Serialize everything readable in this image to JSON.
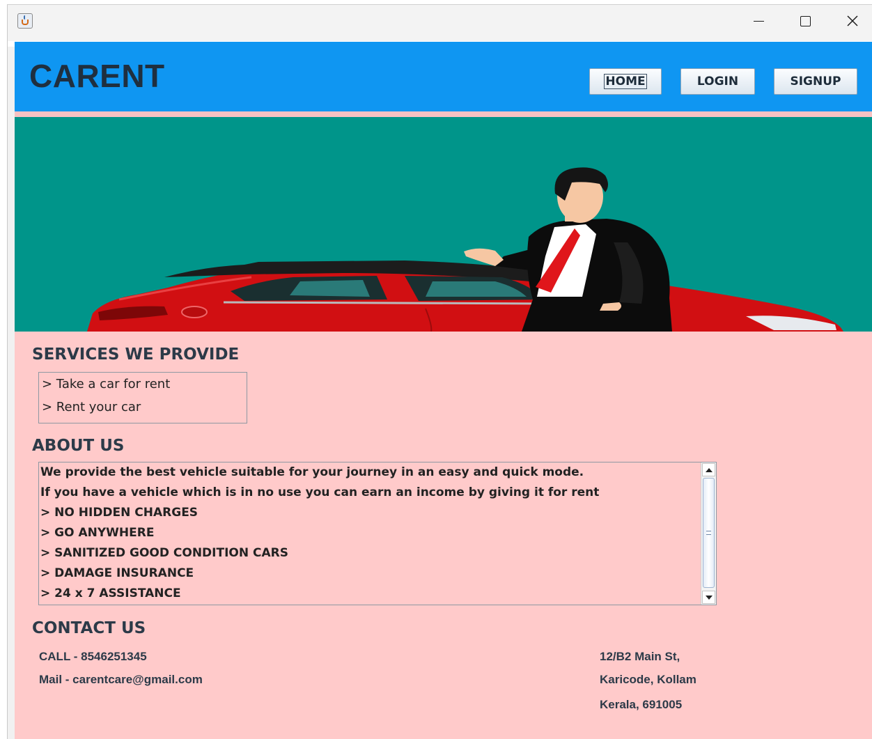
{
  "window": {
    "app_icon": "java-coffee-cup-icon",
    "controls": [
      "minimize-icon",
      "maximize-icon",
      "close-icon"
    ]
  },
  "header": {
    "brand": "CARENT",
    "nav": {
      "home": "HOME",
      "login": "LOGIN",
      "signup": "SIGNUP"
    },
    "colors": {
      "background": "#0f96f2",
      "strip": "#f7c2c3"
    }
  },
  "hero": {
    "background": "#00958a",
    "image": "red-car-with-businessman-illustration"
  },
  "services": {
    "title": "SERVICES WE PROVIDE",
    "items": [
      "> Take a car for rent",
      "> Rent your car"
    ]
  },
  "about": {
    "title": "ABOUT US",
    "lines": [
      "We provide the best vehicle suitable for your journey in an easy and quick mode.",
      "If you have a vehicle which is in no use you can earn an income by giving it for rent",
      "> NO HIDDEN CHARGES",
      "> GO ANYWHERE",
      "> SANITIZED GOOD CONDITION CARS",
      "> DAMAGE INSURANCE",
      "> 24 x 7 ASSISTANCE"
    ]
  },
  "contact": {
    "title": "CONTACT US",
    "call": "CALL - 8546251345",
    "mail": "Mail - carentcare@gmail.com",
    "address": [
      "12/B2 Main St,",
      "Karicode, Kollam",
      "Kerala, 691005"
    ]
  },
  "colors": {
    "content_background": "#ffcaca",
    "heading": "#2c3a48"
  }
}
